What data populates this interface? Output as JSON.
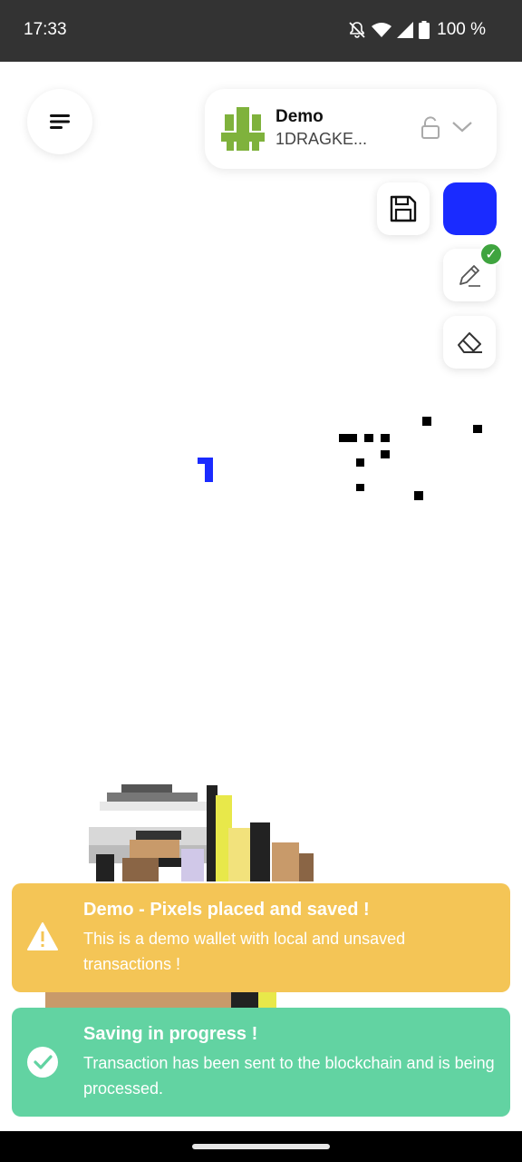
{
  "status_bar": {
    "time": "17:33",
    "battery": "100 %",
    "icons": [
      "bell-off-icon",
      "wifi-icon",
      "signal-icon",
      "battery-icon"
    ]
  },
  "header": {
    "menu_icon": "hamburger-menu-icon",
    "wallet": {
      "name": "Demo",
      "address": "1DRAGKE...",
      "logo_icon": "dragonchain-logo",
      "lock_icon": "unlocked-padlock-icon",
      "dropdown_icon": "chevron-down-icon"
    }
  },
  "tools": {
    "save_icon": "save-icon",
    "selected_color": "#1a2bff",
    "pencil_icon": "pencil-icon",
    "pencil_active": true,
    "eraser_icon": "eraser-icon",
    "check_glyph": "✓"
  },
  "canvas": {
    "background": "#ffffff"
  },
  "toasts": [
    {
      "type": "warning",
      "color": "#f4c556",
      "icon": "warning-icon",
      "title": "Demo - Pixels placed and saved !",
      "message": "This is a demo wallet with local and unsaved transactions !"
    },
    {
      "type": "success",
      "color": "#62d3a2",
      "icon": "check-circle-icon",
      "title": "Saving in progress !",
      "message": "Transaction has been sent to the blockchain and is being processed."
    }
  ]
}
